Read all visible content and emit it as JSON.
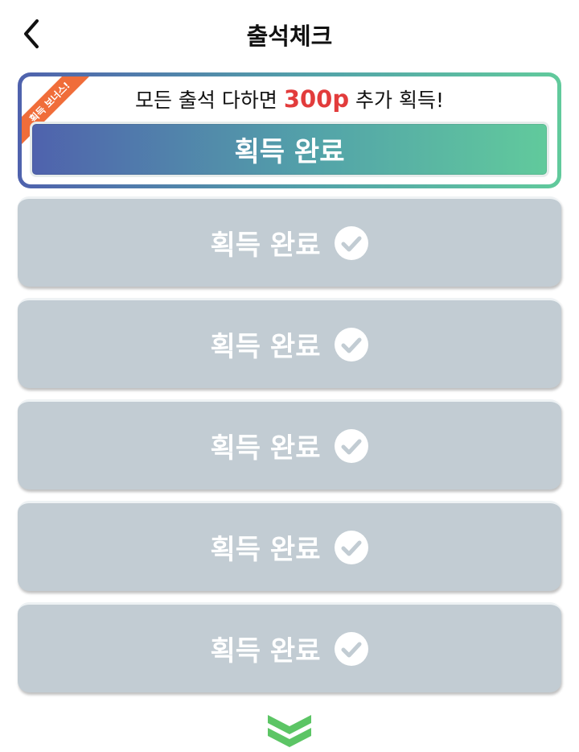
{
  "header": {
    "title": "출석체크",
    "back_icon": "chevron-left-icon"
  },
  "bonus": {
    "ribbon": "획득 보너스!",
    "text_before": "모든 출석 다하면 ",
    "amount": "300p",
    "text_after": " 추가 획득!",
    "button_label": "획득 완료",
    "colors": {
      "gradient_start": "#4f62ad",
      "gradient_end": "#61ca9c",
      "amount": "#e23c3c",
      "ribbon": "#f06d3a"
    }
  },
  "rows": [
    {
      "label": "획득 완료",
      "icon": "check-circle-icon"
    },
    {
      "label": "획득 완료",
      "icon": "check-circle-icon"
    },
    {
      "label": "획득 완료",
      "icon": "check-circle-icon"
    },
    {
      "label": "획득 완료",
      "icon": "check-circle-icon"
    },
    {
      "label": "획득 완료",
      "icon": "check-circle-icon"
    }
  ],
  "footer": {
    "icon": "double-chevron-down-icon",
    "color": "#5cc565"
  }
}
